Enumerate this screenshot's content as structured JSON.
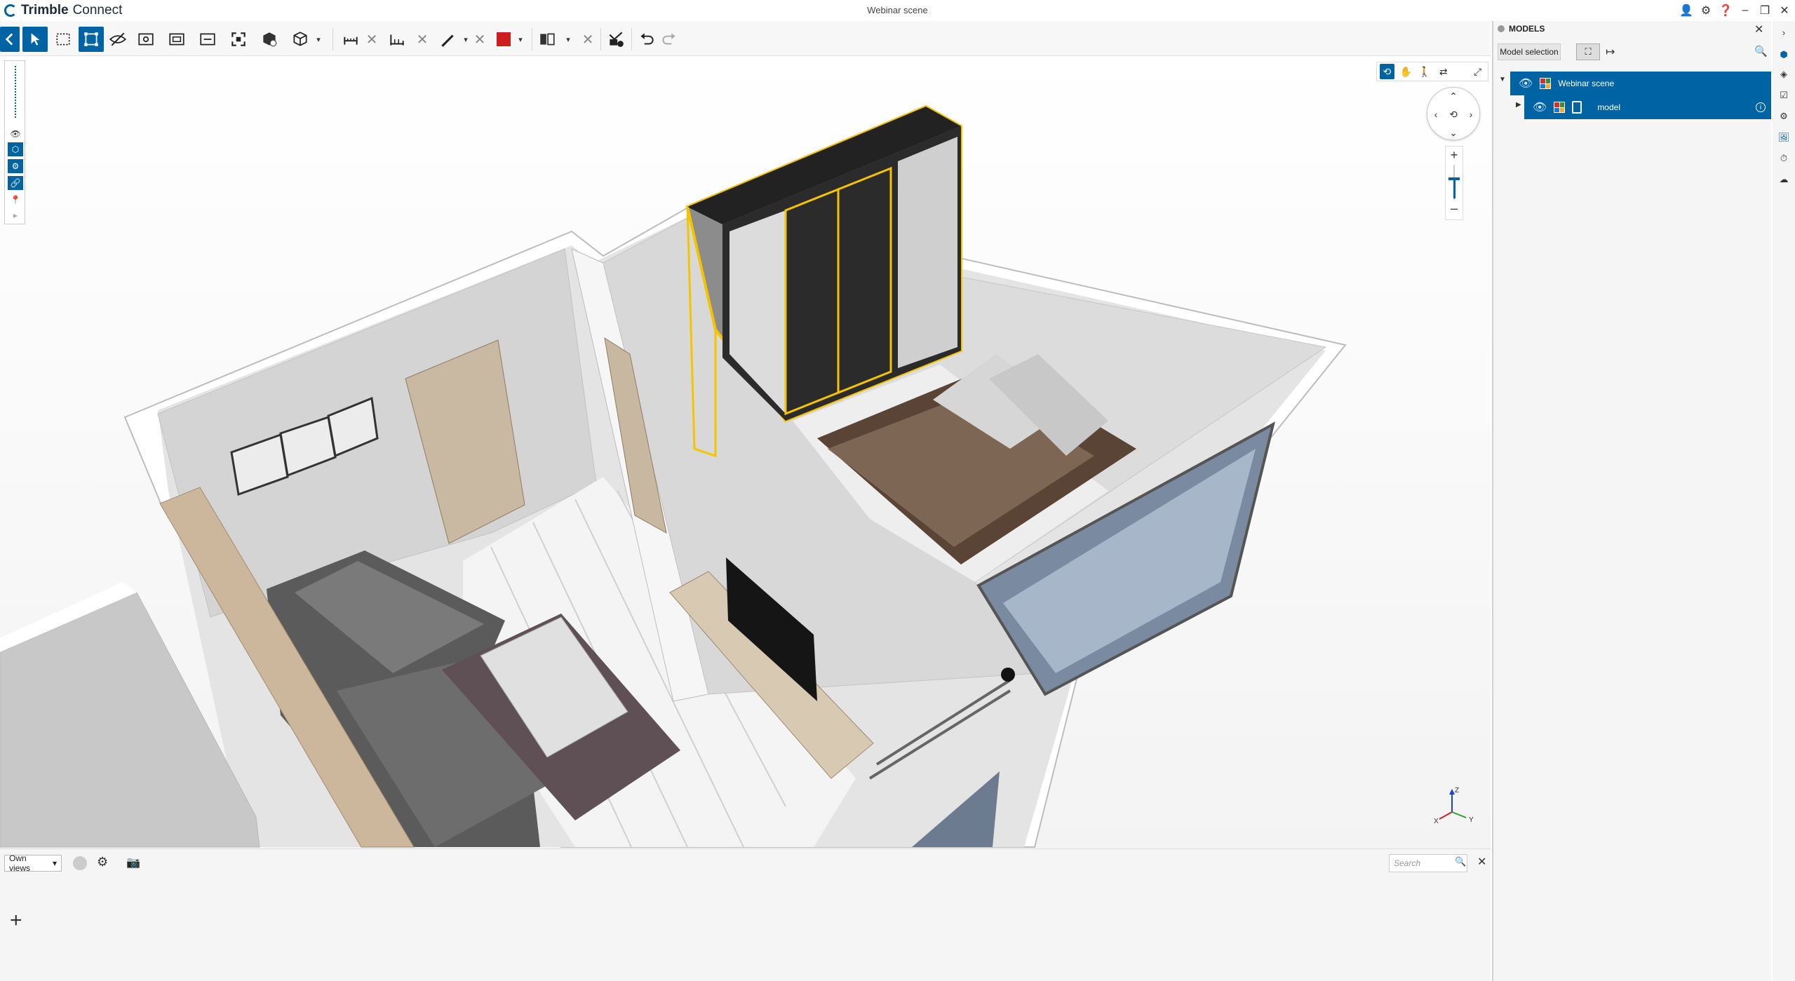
{
  "app": {
    "brand_bold": "Trimble",
    "brand_light": "Connect",
    "scene_title": "Webinar scene"
  },
  "colors": {
    "accent": "#0063a3",
    "selection_outline": "#f5c400",
    "color_swatch": "#cc1e1e"
  },
  "toolbar": {
    "icons": [
      "back-arrow-icon",
      "select-arrow-icon",
      "box-select-icon",
      "fit-selection-icon",
      "hide-icon",
      "isolate-icon",
      "clip-icon",
      "section-icon",
      "fit-all-icon",
      "object-box-icon",
      "cube-view-icon",
      "measure-icon",
      "measure-area-icon",
      "markup-pen-icon",
      "color-swatch-icon",
      "sections-split-icon",
      "presentation-icon",
      "undo-icon",
      "redo-icon"
    ]
  },
  "side_tools": {
    "icons": [
      "ruler-icon",
      "eye-icon",
      "shield-icon",
      "gear-icon",
      "link-icon",
      "pin-icon",
      "expand-icon"
    ]
  },
  "viewport": {
    "axes": {
      "x": "X",
      "y": "Y",
      "z": "Z"
    }
  },
  "views_panel": {
    "dropdown_label": "Own views",
    "search_placeholder": "Search",
    "add_label": "+"
  },
  "models_panel": {
    "title": "MODELS",
    "model_selection_label": "Model selection",
    "tree": [
      {
        "label": "Webinar scene",
        "selected": true
      },
      {
        "label": "model",
        "selected": true
      }
    ]
  }
}
